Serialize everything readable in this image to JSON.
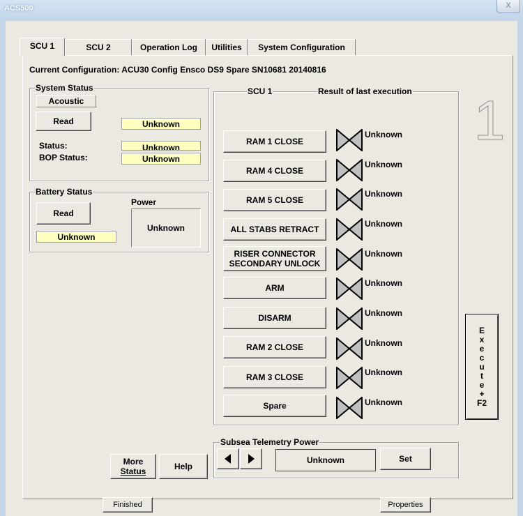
{
  "window": {
    "title": "ACS500",
    "close_glyph": "X"
  },
  "tabs": [
    "SCU 1",
    "SCU 2",
    "Operation Log",
    "Utilities",
    "System Configuration"
  ],
  "active_tab": "SCU 1",
  "current_configuration": "Current Configuration: ACU30 Config Ensco DS9 Spare SN10681  20140816",
  "system_status": {
    "group_label": "System Status",
    "acoustic_label": "Acoustic",
    "read_label": "Read",
    "read_value": "Unknown",
    "status_label": "Status:",
    "status_value": "Unknown",
    "bop_status_label": "BOP Status:",
    "bop_status_value": "Unknown"
  },
  "battery_status": {
    "group_label": "Battery Status",
    "read_label": "Read",
    "read_value": "Unknown",
    "power_label": "Power",
    "power_value": "Unknown"
  },
  "scu_panel": {
    "group_label": "SCU 1",
    "result_header": "Result of last execution",
    "functions": [
      {
        "label": "RAM 1 CLOSE",
        "result": "Unknown",
        "icon": "valve-icon"
      },
      {
        "label": "RAM 4 CLOSE",
        "result": "Unknown",
        "icon": "valve-icon"
      },
      {
        "label": "RAM 5 CLOSE",
        "result": "Unknown",
        "icon": "valve-icon"
      },
      {
        "label": "ALL STABS RETRACT",
        "result": "Unknown",
        "icon": "valve-icon"
      },
      {
        "label_line1": "RISER CONNECTOR",
        "label_line2": "SECONDARY UNLOCK",
        "result": "Unknown",
        "icon": "valve-icon"
      },
      {
        "label": "ARM",
        "result": "Unknown",
        "icon": "valve-icon"
      },
      {
        "label": "DISARM",
        "result": "Unknown",
        "icon": "valve-icon"
      },
      {
        "label": "RAM 2 CLOSE",
        "result": "Unknown",
        "icon": "valve-icon"
      },
      {
        "label": "RAM 3 CLOSE",
        "result": "Unknown",
        "icon": "valve-icon"
      },
      {
        "label": "Spare",
        "result": "Unknown",
        "icon": "valve-icon"
      }
    ]
  },
  "scu_number": "1",
  "execute_button": [
    "E",
    "x",
    "e",
    "c",
    "u",
    "t",
    "e",
    "+",
    "F2"
  ],
  "subsea_telemetry": {
    "group_label": "Subsea Telemetry Power",
    "value": "Unknown",
    "set_label": "Set",
    "prev_icon": "left-arrow-icon",
    "next_icon": "right-arrow-icon"
  },
  "more_status": {
    "line1": "More",
    "line2": "Status"
  },
  "help_label": "Help",
  "footer": {
    "finished_label": "Finished",
    "properties_label": "Properties"
  }
}
